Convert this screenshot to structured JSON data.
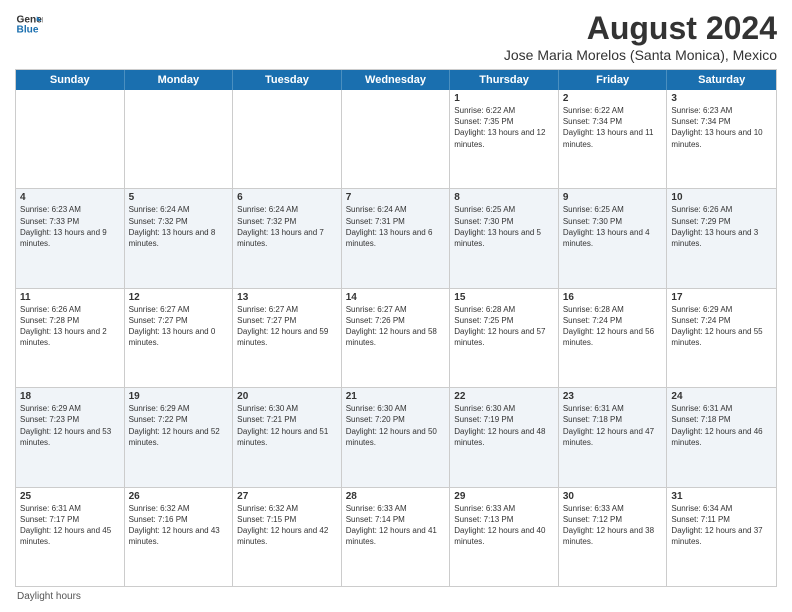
{
  "logo": {
    "line1": "General",
    "line2": "Blue"
  },
  "title": "August 2024",
  "subtitle": "Jose Maria Morelos (Santa Monica), Mexico",
  "header_days": [
    "Sunday",
    "Monday",
    "Tuesday",
    "Wednesday",
    "Thursday",
    "Friday",
    "Saturday"
  ],
  "weeks": [
    {
      "alt": false,
      "cells": [
        {
          "day": "",
          "info": ""
        },
        {
          "day": "",
          "info": ""
        },
        {
          "day": "",
          "info": ""
        },
        {
          "day": "",
          "info": ""
        },
        {
          "day": "1",
          "info": "Sunrise: 6:22 AM\nSunset: 7:35 PM\nDaylight: 13 hours and 12 minutes."
        },
        {
          "day": "2",
          "info": "Sunrise: 6:22 AM\nSunset: 7:34 PM\nDaylight: 13 hours and 11 minutes."
        },
        {
          "day": "3",
          "info": "Sunrise: 6:23 AM\nSunset: 7:34 PM\nDaylight: 13 hours and 10 minutes."
        }
      ]
    },
    {
      "alt": true,
      "cells": [
        {
          "day": "4",
          "info": "Sunrise: 6:23 AM\nSunset: 7:33 PM\nDaylight: 13 hours and 9 minutes."
        },
        {
          "day": "5",
          "info": "Sunrise: 6:24 AM\nSunset: 7:32 PM\nDaylight: 13 hours and 8 minutes."
        },
        {
          "day": "6",
          "info": "Sunrise: 6:24 AM\nSunset: 7:32 PM\nDaylight: 13 hours and 7 minutes."
        },
        {
          "day": "7",
          "info": "Sunrise: 6:24 AM\nSunset: 7:31 PM\nDaylight: 13 hours and 6 minutes."
        },
        {
          "day": "8",
          "info": "Sunrise: 6:25 AM\nSunset: 7:30 PM\nDaylight: 13 hours and 5 minutes."
        },
        {
          "day": "9",
          "info": "Sunrise: 6:25 AM\nSunset: 7:30 PM\nDaylight: 13 hours and 4 minutes."
        },
        {
          "day": "10",
          "info": "Sunrise: 6:26 AM\nSunset: 7:29 PM\nDaylight: 13 hours and 3 minutes."
        }
      ]
    },
    {
      "alt": false,
      "cells": [
        {
          "day": "11",
          "info": "Sunrise: 6:26 AM\nSunset: 7:28 PM\nDaylight: 13 hours and 2 minutes."
        },
        {
          "day": "12",
          "info": "Sunrise: 6:27 AM\nSunset: 7:27 PM\nDaylight: 13 hours and 0 minutes."
        },
        {
          "day": "13",
          "info": "Sunrise: 6:27 AM\nSunset: 7:27 PM\nDaylight: 12 hours and 59 minutes."
        },
        {
          "day": "14",
          "info": "Sunrise: 6:27 AM\nSunset: 7:26 PM\nDaylight: 12 hours and 58 minutes."
        },
        {
          "day": "15",
          "info": "Sunrise: 6:28 AM\nSunset: 7:25 PM\nDaylight: 12 hours and 57 minutes."
        },
        {
          "day": "16",
          "info": "Sunrise: 6:28 AM\nSunset: 7:24 PM\nDaylight: 12 hours and 56 minutes."
        },
        {
          "day": "17",
          "info": "Sunrise: 6:29 AM\nSunset: 7:24 PM\nDaylight: 12 hours and 55 minutes."
        }
      ]
    },
    {
      "alt": true,
      "cells": [
        {
          "day": "18",
          "info": "Sunrise: 6:29 AM\nSunset: 7:23 PM\nDaylight: 12 hours and 53 minutes."
        },
        {
          "day": "19",
          "info": "Sunrise: 6:29 AM\nSunset: 7:22 PM\nDaylight: 12 hours and 52 minutes."
        },
        {
          "day": "20",
          "info": "Sunrise: 6:30 AM\nSunset: 7:21 PM\nDaylight: 12 hours and 51 minutes."
        },
        {
          "day": "21",
          "info": "Sunrise: 6:30 AM\nSunset: 7:20 PM\nDaylight: 12 hours and 50 minutes."
        },
        {
          "day": "22",
          "info": "Sunrise: 6:30 AM\nSunset: 7:19 PM\nDaylight: 12 hours and 48 minutes."
        },
        {
          "day": "23",
          "info": "Sunrise: 6:31 AM\nSunset: 7:18 PM\nDaylight: 12 hours and 47 minutes."
        },
        {
          "day": "24",
          "info": "Sunrise: 6:31 AM\nSunset: 7:18 PM\nDaylight: 12 hours and 46 minutes."
        }
      ]
    },
    {
      "alt": false,
      "cells": [
        {
          "day": "25",
          "info": "Sunrise: 6:31 AM\nSunset: 7:17 PM\nDaylight: 12 hours and 45 minutes."
        },
        {
          "day": "26",
          "info": "Sunrise: 6:32 AM\nSunset: 7:16 PM\nDaylight: 12 hours and 43 minutes."
        },
        {
          "day": "27",
          "info": "Sunrise: 6:32 AM\nSunset: 7:15 PM\nDaylight: 12 hours and 42 minutes."
        },
        {
          "day": "28",
          "info": "Sunrise: 6:33 AM\nSunset: 7:14 PM\nDaylight: 12 hours and 41 minutes."
        },
        {
          "day": "29",
          "info": "Sunrise: 6:33 AM\nSunset: 7:13 PM\nDaylight: 12 hours and 40 minutes."
        },
        {
          "day": "30",
          "info": "Sunrise: 6:33 AM\nSunset: 7:12 PM\nDaylight: 12 hours and 38 minutes."
        },
        {
          "day": "31",
          "info": "Sunrise: 6:34 AM\nSunset: 7:11 PM\nDaylight: 12 hours and 37 minutes."
        }
      ]
    }
  ],
  "footer": "Daylight hours"
}
